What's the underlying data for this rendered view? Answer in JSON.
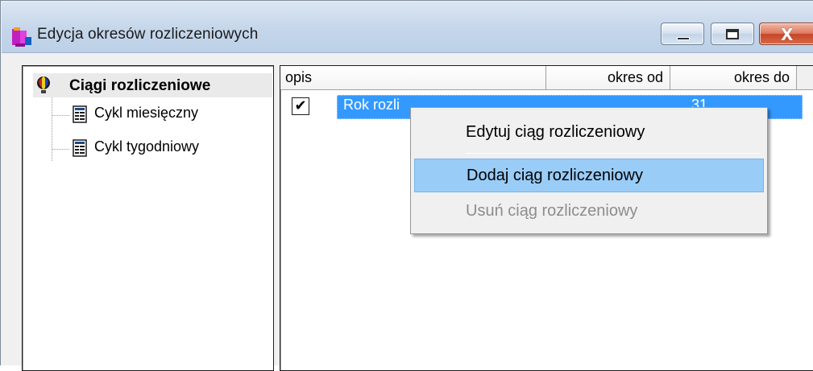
{
  "window": {
    "title": "Edycja okresów rozliczeniowych",
    "buttons": {
      "minimize": "minimize",
      "maximize": "maximize",
      "close": "close"
    }
  },
  "tree": {
    "root_label": "Ciągi rozliczeniowe",
    "items": [
      {
        "label": "Cykl miesięczny",
        "icon": "document-icon"
      },
      {
        "label": "Cykl tygodniowy",
        "icon": "document-icon"
      }
    ]
  },
  "list": {
    "columns": [
      "opis",
      "okres od",
      "okres do"
    ],
    "rows": [
      {
        "checked": true,
        "check_glyph": "✔",
        "opis": "Rok rozli",
        "okres_od": "",
        "okres_do": "31"
      }
    ]
  },
  "context_menu": {
    "items": [
      {
        "label": "Edytuj ciąg rozliczeniowy",
        "state": "normal"
      },
      {
        "label": "Dodaj ciąg rozliczeniowy",
        "state": "hover"
      },
      {
        "label": "Usuń ciąg rozliczeniowy",
        "state": "disabled"
      }
    ]
  },
  "colors": {
    "selection": "#3399ff",
    "menu_hover": "#99ccf7",
    "disabled_text": "#8d8d8d"
  }
}
